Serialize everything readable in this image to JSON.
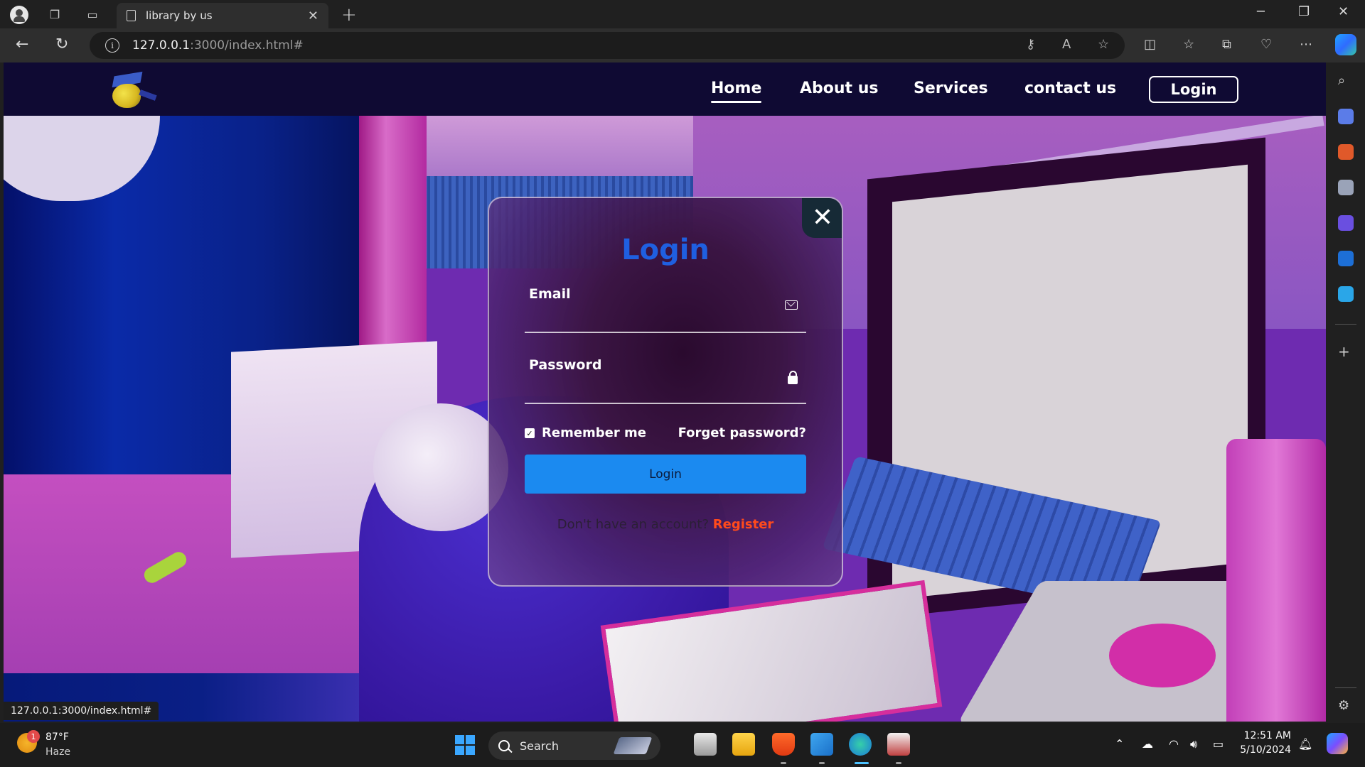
{
  "browser": {
    "tab_title": "library by us",
    "url_host": "127.0.0.1",
    "url_path": ":3000/index.html#",
    "status_url": "127.0.0.1:3000/index.html#"
  },
  "site": {
    "nav": {
      "home": "Home",
      "about": "About us",
      "services": "Services",
      "contact": "contact us",
      "login": "Login"
    },
    "active_nav": "home"
  },
  "login_modal": {
    "title": "Login",
    "close_symbol": "✕",
    "email_label": "Email",
    "email_value": "",
    "password_label": "Password",
    "password_value": "",
    "remember_label": "Remember me",
    "remember_checked": true,
    "forgot_label": "Forget password?",
    "submit_label": "Login",
    "register_prompt": "Don't have an account?",
    "register_link": "Register",
    "colors": {
      "title": "#1f5fe0",
      "submit_bg": "#1b8af0",
      "register_link": "#ff4a1c"
    }
  },
  "taskbar": {
    "weather_temp": "87°F",
    "weather_desc": "Haze",
    "weather_badge": "1",
    "search_placeholder": "Search",
    "time": "12:51 AM",
    "date": "5/10/2024"
  },
  "icons": {
    "email_field": "envelope-icon",
    "password_field": "lock-icon",
    "modal_close": "close-icon"
  }
}
